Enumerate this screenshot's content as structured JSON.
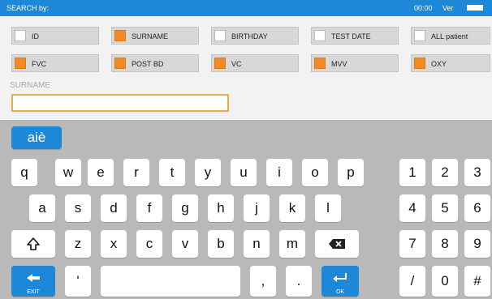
{
  "header": {
    "title": "SEARCH by:",
    "time": "00:00",
    "version_label": "Ver"
  },
  "criteria": [
    {
      "label": "ID",
      "checked": false
    },
    {
      "label": "SURNAME",
      "checked": true
    },
    {
      "label": "BIRTHDAY",
      "checked": false
    },
    {
      "label": "TEST DATE",
      "checked": false
    },
    {
      "label": "ALL patient",
      "checked": false
    },
    {
      "label": "FVC",
      "checked": true
    },
    {
      "label": "POST BD",
      "checked": true
    },
    {
      "label": "VC",
      "checked": true
    },
    {
      "label": "MVV",
      "checked": true
    },
    {
      "label": "OXY",
      "checked": true
    }
  ],
  "search": {
    "label": "SURNAME",
    "value": ""
  },
  "keyboard": {
    "lang_key": "aiè",
    "row1": [
      "q",
      "w",
      "e",
      "r",
      "t",
      "y",
      "u",
      "i",
      "o",
      "p"
    ],
    "row2": [
      "a",
      "s",
      "d",
      "f",
      "g",
      "h",
      "j",
      "k",
      "l"
    ],
    "row3": [
      "z",
      "x",
      "c",
      "v",
      "b",
      "n",
      "m"
    ],
    "row4_punct": [
      "'",
      ",",
      "."
    ],
    "numpad": [
      "1",
      "2",
      "3",
      "4",
      "5",
      "6",
      "7",
      "8",
      "9",
      "/",
      "0",
      "#"
    ],
    "exit_label": "EXIT",
    "ok_label": "OK"
  },
  "colors": {
    "accent_blue": "#1e88d8",
    "check_orange": "#f08a24",
    "field_border": "#f2a948"
  }
}
